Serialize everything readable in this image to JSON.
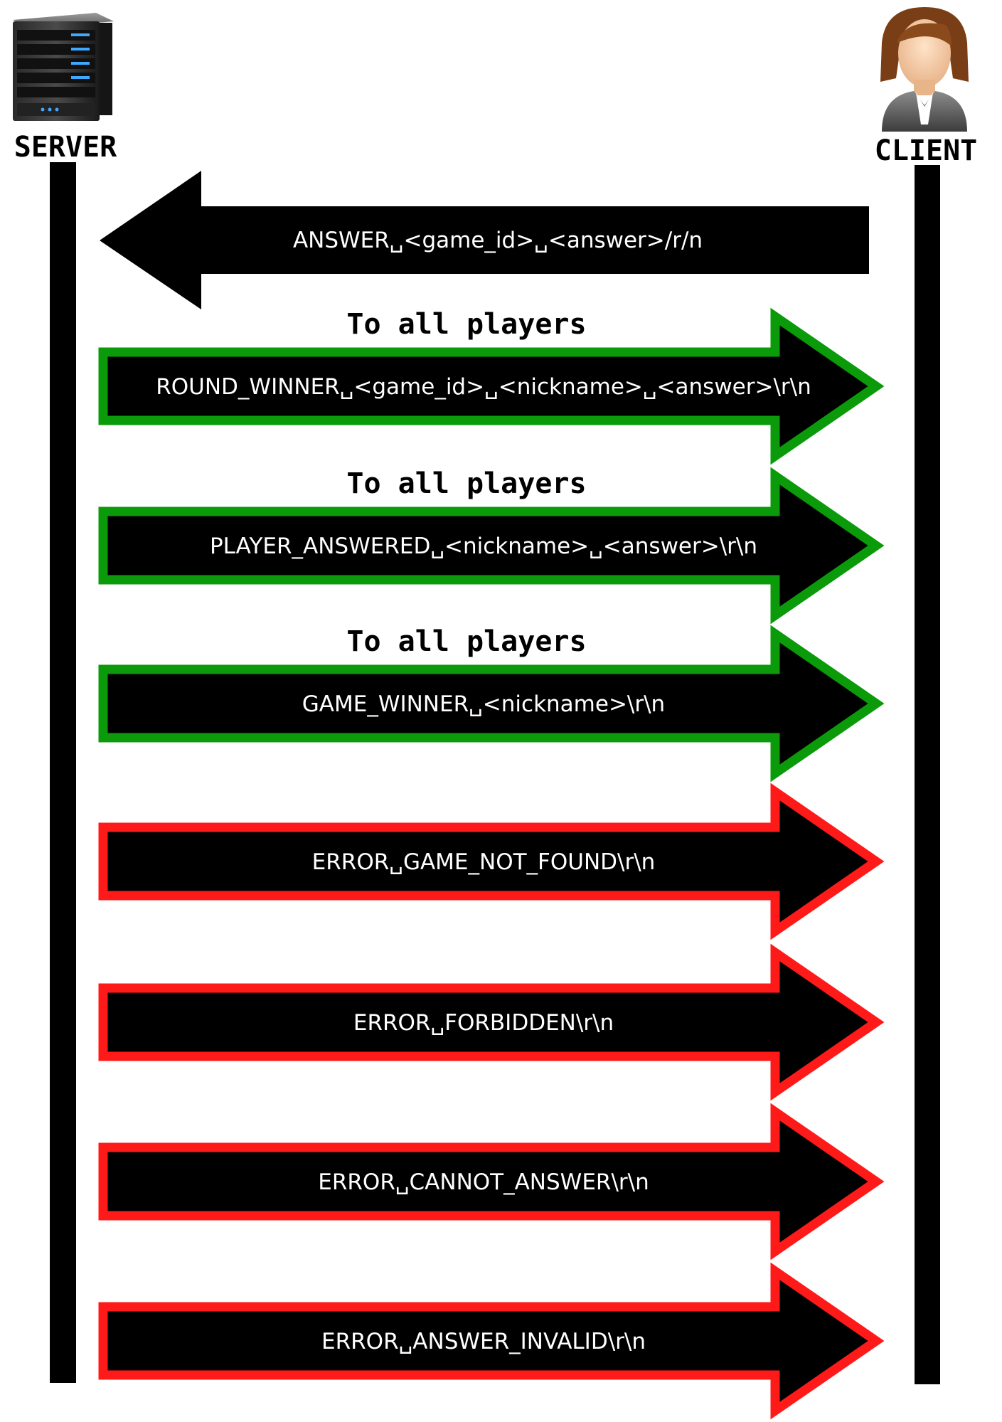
{
  "server": {
    "label": "SERVER",
    "icon": "server-icon"
  },
  "client": {
    "label": "CLIENT",
    "icon": "user-avatar-icon"
  },
  "colors": {
    "ok": "#0a9a0a",
    "error": "#ff1a1a",
    "arrow_fill": "#000000",
    "lifeline": "#000000"
  },
  "request": {
    "text": "ANSWER␣<game_id>␣<answer>/r/n",
    "direction": "client-to-server"
  },
  "responses": [
    {
      "text": "ROUND_WINNER␣<game_id>␣<nickname>␣<answer>\\r\\n",
      "note": "To all players",
      "status": "ok"
    },
    {
      "text": "PLAYER_ANSWERED␣<nickname>␣<answer>\\r\\n",
      "note": "To all players",
      "status": "ok"
    },
    {
      "text": "GAME_WINNER␣<nickname>\\r\\n",
      "note": "To all players",
      "status": "ok"
    },
    {
      "text": "ERROR␣GAME_NOT_FOUND\\r\\n",
      "note": "",
      "status": "error"
    },
    {
      "text": "ERROR␣FORBIDDEN\\r\\n",
      "note": "",
      "status": "error"
    },
    {
      "text": "ERROR␣CANNOT_ANSWER\\r\\n",
      "note": "",
      "status": "error"
    },
    {
      "text": "ERROR␣ANSWER_INVALID\\r\\n",
      "note": "",
      "status": "error"
    }
  ]
}
